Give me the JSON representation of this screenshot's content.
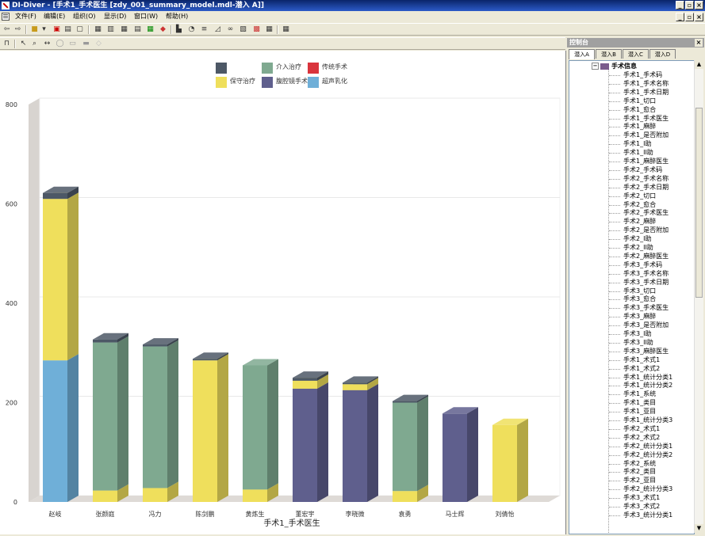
{
  "window": {
    "title": "DI-Diver - [手术1_手术医生 [zdy_001_summary_model.mdl-潜入 A]]"
  },
  "menu": [
    {
      "label": "文件(F)"
    },
    {
      "label": "编辑(E)"
    },
    {
      "label": "组织(O)"
    },
    {
      "label": "显示(D)"
    },
    {
      "label": "窗口(W)"
    },
    {
      "label": "帮助(H)"
    }
  ],
  "console": {
    "title": "控制台",
    "tabs": [
      {
        "label": "潜入A"
      },
      {
        "label": "潜入B"
      },
      {
        "label": "潜入C"
      },
      {
        "label": "潜入D"
      }
    ],
    "tree_root": "手术信息",
    "tree_items": [
      "手术1_手术码",
      "手术1_手术名称",
      "手术1_手术日期",
      "手术1_切口",
      "手术1_愈合",
      "手术1_手术医生",
      "手术1_麻醉",
      "手术1_是否附加",
      "手术1_I助",
      "手术1_II助",
      "手术1_麻醉医生",
      "手术2_手术码",
      "手术2_手术名称",
      "手术2_手术日期",
      "手术2_切口",
      "手术2_愈合",
      "手术2_手术医生",
      "手术2_麻醉",
      "手术2_是否附加",
      "手术2_I助",
      "手术2_II助",
      "手术2_麻醉医生",
      "手术3_手术码",
      "手术3_手术名称",
      "手术3_手术日期",
      "手术3_切口",
      "手术3_愈合",
      "手术3_手术医生",
      "手术3_麻醉",
      "手术3_是否附加",
      "手术3_I助",
      "手术3_II助",
      "手术3_麻醉医生",
      "手术1_术式1",
      "手术1_术式2",
      "手术1_统计分类1",
      "手术1_统计分类2",
      "手术1_系统",
      "手术1_类目",
      "手术1_亚目",
      "手术1_统计分类3",
      "手术2_术式1",
      "手术2_术式2",
      "手术2_统计分类1",
      "手术2_统计分类2",
      "手术2_系统",
      "手术2_类目",
      "手术2_亚目",
      "手术2_统计分类3",
      "手术3_术式1",
      "手术3_术式2",
      "手术3_统计分类1"
    ]
  },
  "chart_data": {
    "type": "bar",
    "stacked": true,
    "title": "",
    "xlabel": "手术1_手术医生",
    "ylabel": "",
    "ylim": [
      0,
      800
    ],
    "yticks": [
      0,
      200,
      400,
      600,
      800
    ],
    "categories": [
      "赵岐",
      "张颜庭",
      "冯力",
      "陈剑鹏",
      "黄炼生",
      "董宏宇",
      "李晓微",
      "袁勇",
      "马士辉",
      "刘倩怡"
    ],
    "legend_position": "top",
    "series": [
      {
        "name": "",
        "color": "#4d5866",
        "values": [
          12,
          6,
          4,
          3,
          0,
          6,
          3,
          3,
          0,
          0
        ]
      },
      {
        "name": "介入治疗",
        "color": "#7fa990",
        "values": [
          0,
          298,
          285,
          0,
          250,
          0,
          0,
          178,
          0,
          0
        ]
      },
      {
        "name": "传统手术",
        "color": "#d9343c",
        "values": [
          0,
          0,
          0,
          0,
          0,
          0,
          0,
          0,
          0,
          0
        ]
      },
      {
        "name": "保守治疗",
        "color": "#efdf5c",
        "values": [
          325,
          23,
          28,
          285,
          25,
          16,
          12,
          22,
          0,
          155
        ]
      },
      {
        "name": "腹腔镜手术",
        "color": "#5f5f8d",
        "values": [
          0,
          0,
          0,
          0,
          0,
          228,
          225,
          0,
          178,
          0
        ]
      },
      {
        "name": "超声乳化",
        "color": "#6fafd8",
        "values": [
          285,
          0,
          0,
          0,
          0,
          0,
          0,
          0,
          0,
          0
        ]
      }
    ],
    "stack_order": [
      "超声乳化",
      "腹腔镜手术",
      "保守治疗",
      "传统手术",
      "介入治疗",
      ""
    ]
  }
}
